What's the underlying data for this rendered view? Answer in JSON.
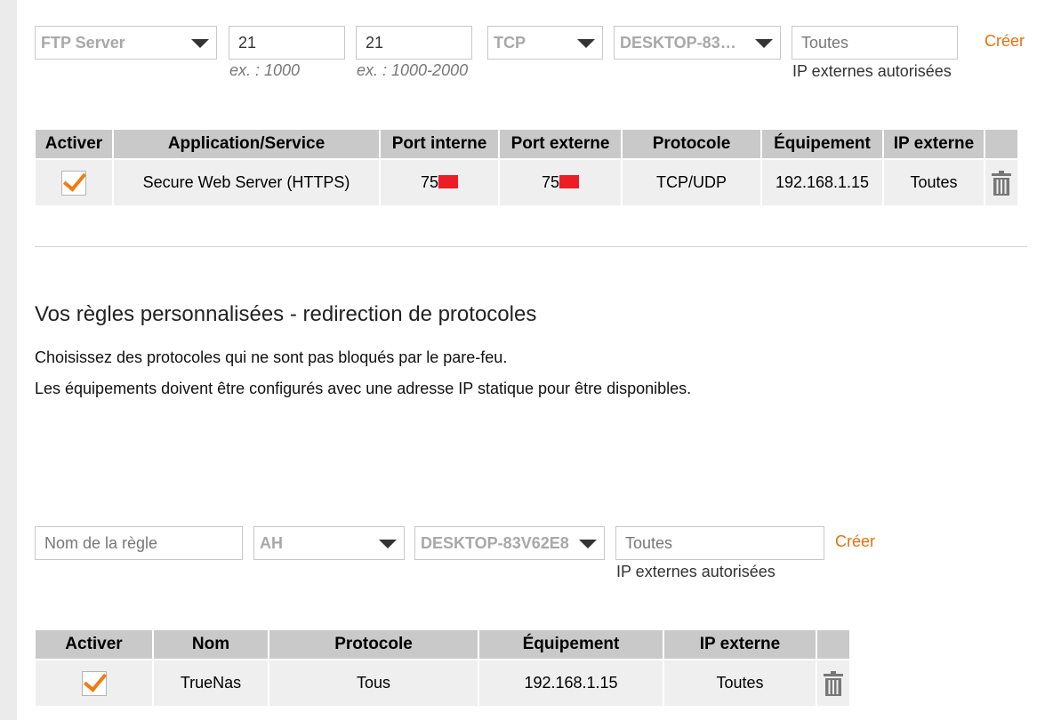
{
  "port_form": {
    "service_select": "FTP Server",
    "internal_port": "21",
    "internal_port_hint": "ex. : 1000",
    "external_port": "21",
    "external_port_hint": "ex. : 1000-2000",
    "protocol_select": "TCP",
    "device_select": "DESKTOP-83…",
    "ip_value": "Toutes",
    "ip_caption": "IP externes autorisées",
    "create_label": "Créer"
  },
  "port_table": {
    "headers": [
      "Activer",
      "Application/Service",
      "Port interne",
      "Port externe",
      "Protocole",
      "Équipement",
      "IP externe",
      ""
    ],
    "rows": [
      {
        "enabled": true,
        "service": "Secure Web Server (HTTPS)",
        "internal_port": "75",
        "external_port": "75",
        "protocol": "TCP/UDP",
        "device": "192.168.1.15",
        "external_ip": "Toutes"
      }
    ]
  },
  "protocol_section": {
    "title": "Vos règles personnalisées - redirection de protocoles",
    "line1": "Choisissez des protocoles qui ne sont pas bloqués par le pare-feu.",
    "line2": "Les équipements doivent être configurés avec une adresse IP statique pour être disponibles."
  },
  "protocol_form": {
    "rule_name_placeholder": "Nom de la règle",
    "protocol_select": "AH",
    "device_select": "DESKTOP-83V62E8",
    "ip_value": "Toutes",
    "ip_caption": "IP externes autorisées",
    "create_label": "Créer"
  },
  "protocol_table": {
    "headers": [
      "Activer",
      "Nom",
      "Protocole",
      "Équipement",
      "IP externe",
      ""
    ],
    "rows": [
      {
        "enabled": true,
        "name": "TrueNas",
        "protocol": "Tous",
        "device": "192.168.1.15",
        "external_ip": "Toutes"
      }
    ]
  },
  "colors": {
    "accent": "#e8700e",
    "header_bg": "#c9c9c9",
    "row_bg": "#efefef",
    "redaction": "#ee1c25"
  }
}
